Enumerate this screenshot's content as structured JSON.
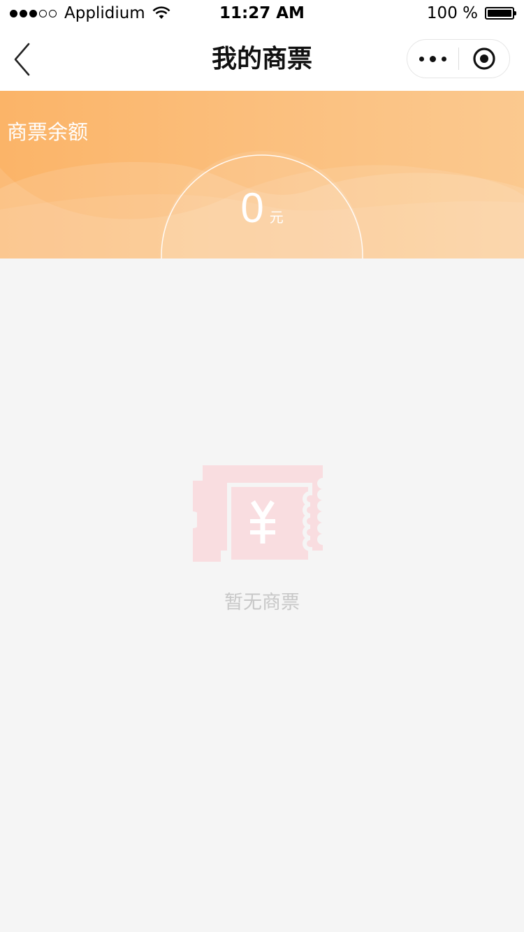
{
  "status_bar": {
    "carrier": "Applidium",
    "time": "11:27 AM",
    "battery": "100 %"
  },
  "nav": {
    "title": "我的商票",
    "back_icon": "chevron-left-icon",
    "more_icon": "more-dots-icon",
    "close_icon": "target-circle-icon"
  },
  "banner": {
    "label": "商票余额",
    "balance_value": "0",
    "balance_unit": "元"
  },
  "empty_state": {
    "icon": "ticket-yen-icon",
    "text": "暂无商票"
  },
  "colors": {
    "banner_start": "#fbb468",
    "banner_end": "#fbc98f",
    "background": "#f5f5f5",
    "empty_icon": "#f9dde0",
    "empty_text": "#c8c8c8"
  }
}
